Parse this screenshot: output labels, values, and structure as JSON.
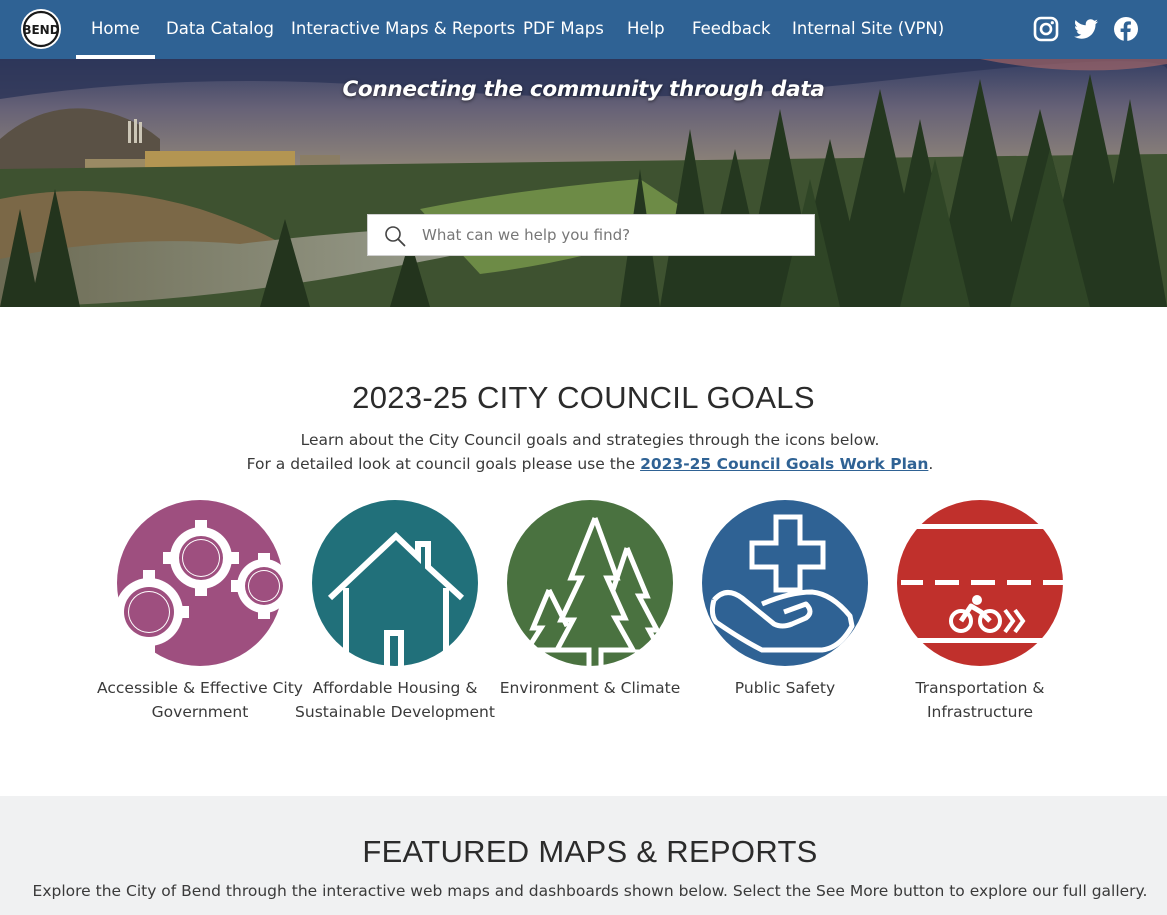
{
  "nav": {
    "logo_alt": "BEND",
    "items": [
      {
        "label": "Home",
        "active": true
      },
      {
        "label": "Data Catalog"
      },
      {
        "label": "Interactive Maps & Reports"
      },
      {
        "label": "PDF Maps"
      },
      {
        "label": "Help"
      },
      {
        "label": "Feedback"
      },
      {
        "label": "Internal Site (VPN)"
      }
    ],
    "social": [
      "instagram-icon",
      "twitter-icon",
      "facebook-icon"
    ]
  },
  "hero": {
    "tagline": "Connecting the community through data",
    "search_placeholder": "What can we help you find?"
  },
  "goals": {
    "title": "2023-25 CITY COUNCIL GOALS",
    "line1": "Learn about the City Council goals and strategies through the icons below.",
    "line2_prefix": "For a detailed look at council goals please use the ",
    "line2_link": "2023-25 Council Goals Work Plan",
    "line2_suffix": ".",
    "items": [
      {
        "label": "Accessible & Effective City Government",
        "icon": "gears-icon",
        "color": "#9e4f7f"
      },
      {
        "label": "Affordable Housing & Sustainable Development",
        "icon": "house-icon",
        "color": "#21707a"
      },
      {
        "label": "Environment & Climate",
        "icon": "trees-icon",
        "color": "#4a7240"
      },
      {
        "label": "Public Safety",
        "icon": "hand-cross-icon",
        "color": "#2f6294"
      },
      {
        "label": "Transportation & Infrastructure",
        "icon": "bike-lane-icon",
        "color": "#c0302c"
      }
    ]
  },
  "featured": {
    "title": "FEATURED MAPS & REPORTS",
    "description": "Explore the City of Bend through the interactive web maps and dashboards shown below.  Select the See More button to explore our full gallery."
  },
  "colors": {
    "nav_bg": "#2f6294",
    "link": "#2f6294",
    "featured_bg": "#f0f1f2"
  }
}
